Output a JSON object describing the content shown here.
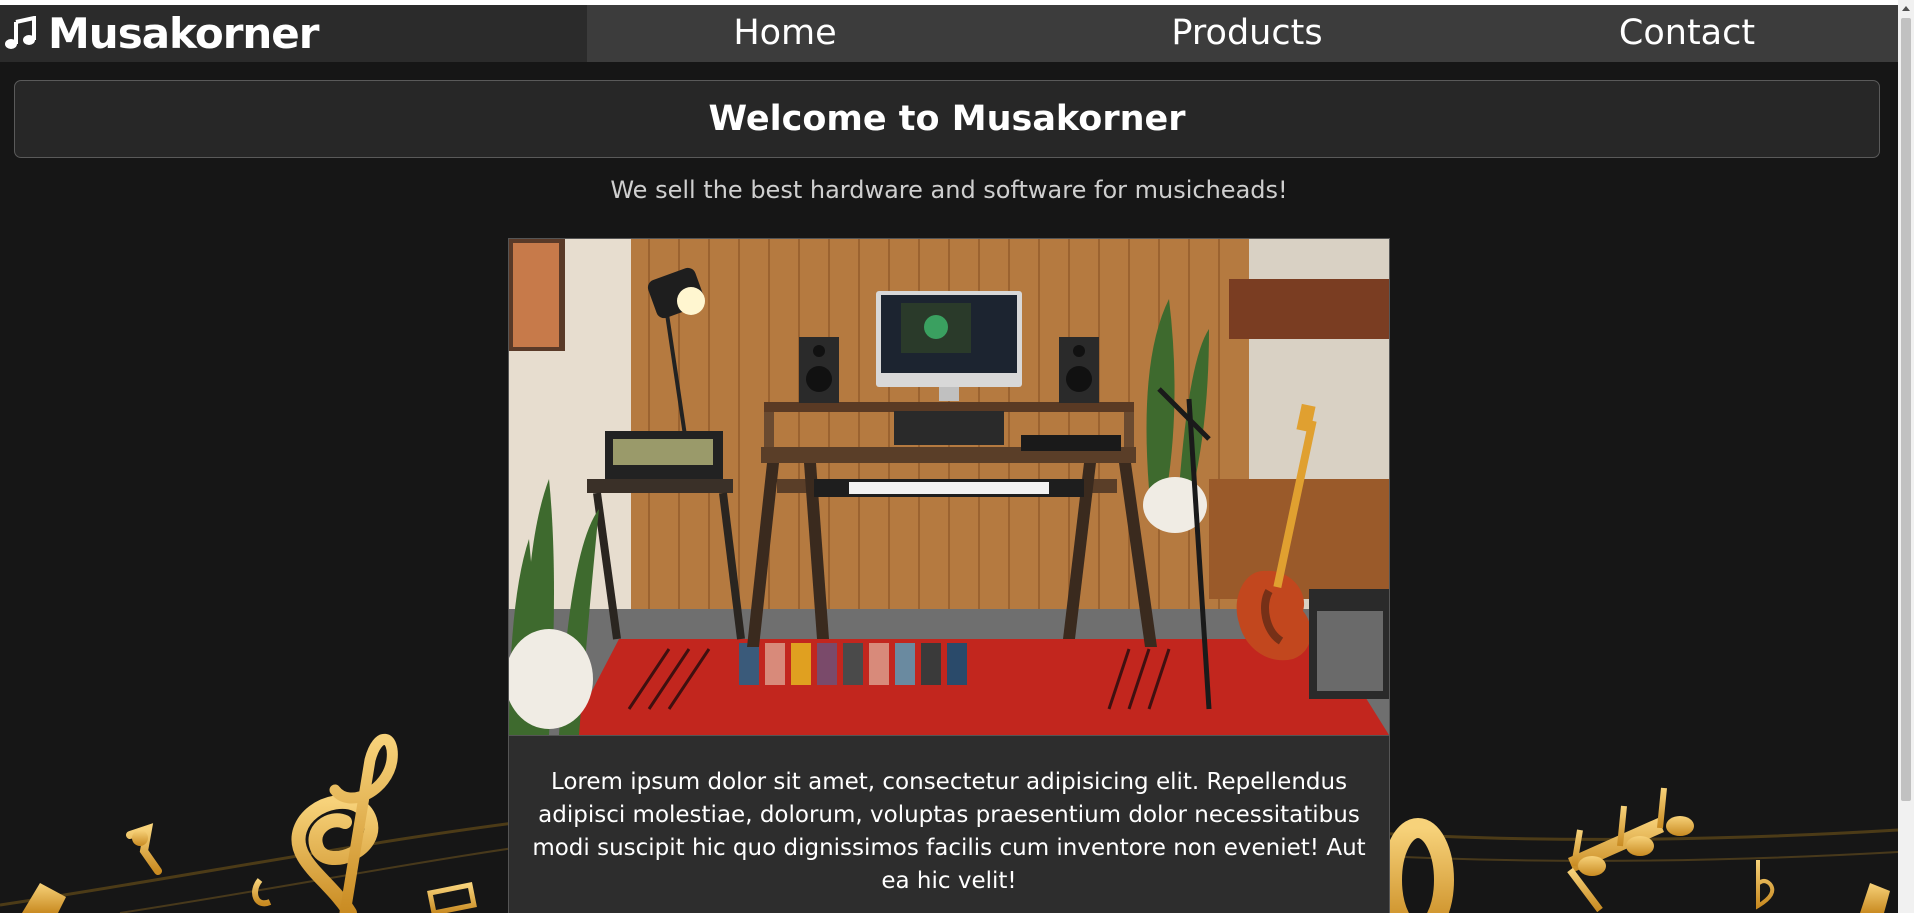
{
  "brand": {
    "name": "Musakorner",
    "logo_icon": "music-note-icon"
  },
  "nav": {
    "items": [
      {
        "label": "Home"
      },
      {
        "label": "Products"
      },
      {
        "label": "Contact"
      }
    ]
  },
  "hero": {
    "title": "Welcome to Musakorner",
    "tagline": "We sell the best hardware and software for musicheads!"
  },
  "card": {
    "image": "music-studio-photo",
    "text": "Lorem ipsum dolor sit amet, consectetur adipisicing elit. Repellendus adipisci molestiae, dolorum, voluptas praesentium dolor necessitatibus modi suscipit hic quo dignissimos facilis cum inventore non eveniet! Aut ea hic velit!"
  },
  "colors": {
    "background": "#161616",
    "topbar": "#2b2b2b",
    "nav_background": "#3c3c3c",
    "card_background": "#2d2d2d",
    "note_gold": "#e8b84a"
  }
}
